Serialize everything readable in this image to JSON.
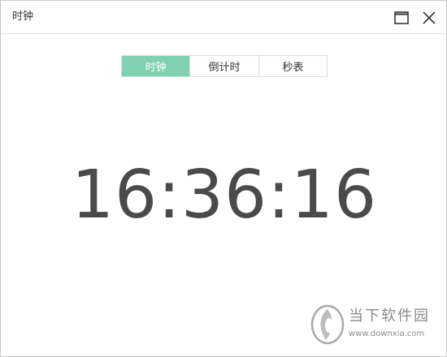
{
  "window": {
    "title": "时钟"
  },
  "tabs": [
    {
      "label": "时钟",
      "active": true
    },
    {
      "label": "倒计时",
      "active": false
    },
    {
      "label": "秒表",
      "active": false
    }
  ],
  "clock": {
    "time": "16:36:16"
  },
  "watermark": {
    "name": "当下软件园",
    "url": "www.downxia.com"
  },
  "icons": {
    "maximize": "maximize-icon",
    "close": "close-icon",
    "logo": "downxia-logo-icon"
  },
  "colors": {
    "accent": "#7fd1b1",
    "clock_text": "#4a4a4a",
    "border": "#dcdcdc"
  }
}
